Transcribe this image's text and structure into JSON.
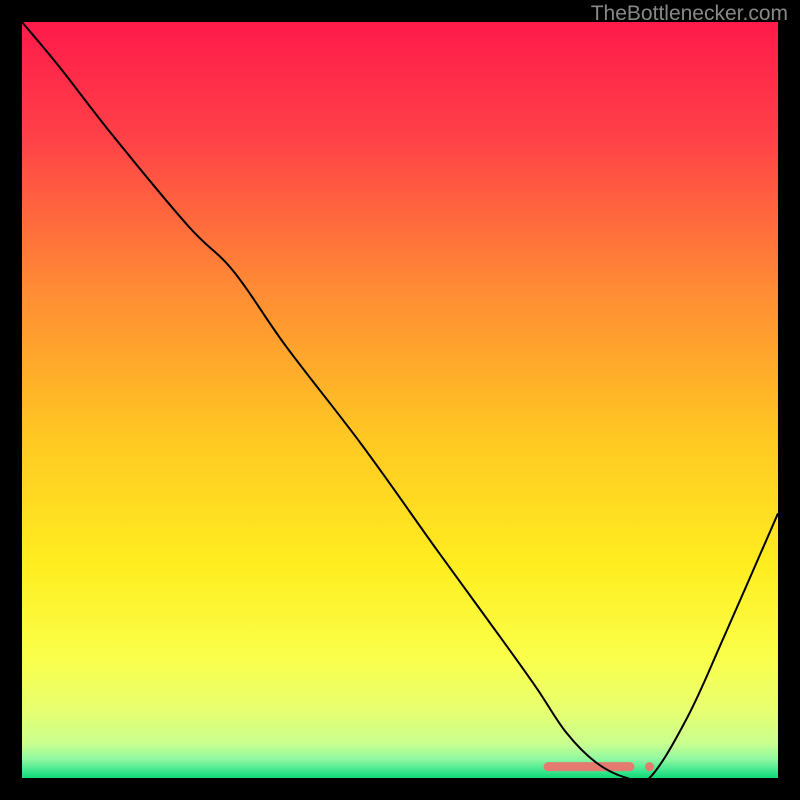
{
  "watermark": "TheBottlenecker.com",
  "chart_data": {
    "type": "line",
    "title": "",
    "xlabel": "",
    "ylabel": "",
    "xlim": [
      0,
      100
    ],
    "ylim": [
      0,
      100
    ],
    "background": {
      "type": "vertical-gradient",
      "stops": [
        {
          "pos": 0.0,
          "color": "#ff1a4a"
        },
        {
          "pos": 0.15,
          "color": "#ff4048"
        },
        {
          "pos": 0.35,
          "color": "#ff8a35"
        },
        {
          "pos": 0.55,
          "color": "#ffc822"
        },
        {
          "pos": 0.72,
          "color": "#ffee20"
        },
        {
          "pos": 0.84,
          "color": "#faff4a"
        },
        {
          "pos": 0.91,
          "color": "#e8ff70"
        },
        {
          "pos": 0.955,
          "color": "#c8ff90"
        },
        {
          "pos": 0.975,
          "color": "#90f8a0"
        },
        {
          "pos": 0.99,
          "color": "#40e890"
        },
        {
          "pos": 1.0,
          "color": "#10d878"
        }
      ]
    },
    "series": [
      {
        "name": "curve",
        "color": "#000000",
        "width": 2,
        "x": [
          0,
          5,
          12,
          22,
          28,
          35,
          45,
          55,
          63,
          68,
          72,
          76,
          80,
          83,
          88,
          93,
          100
        ],
        "y": [
          100,
          94,
          85,
          73,
          67,
          57,
          44,
          30,
          19,
          12,
          6,
          2,
          0,
          0,
          8,
          19,
          35
        ]
      }
    ],
    "markers": {
      "name": "highlight-segment",
      "color": "#e47a70",
      "shape": "rounded-bar",
      "x_start": 69,
      "x_end": 81,
      "y": 1.5,
      "trailing_dot_x": 83
    }
  }
}
